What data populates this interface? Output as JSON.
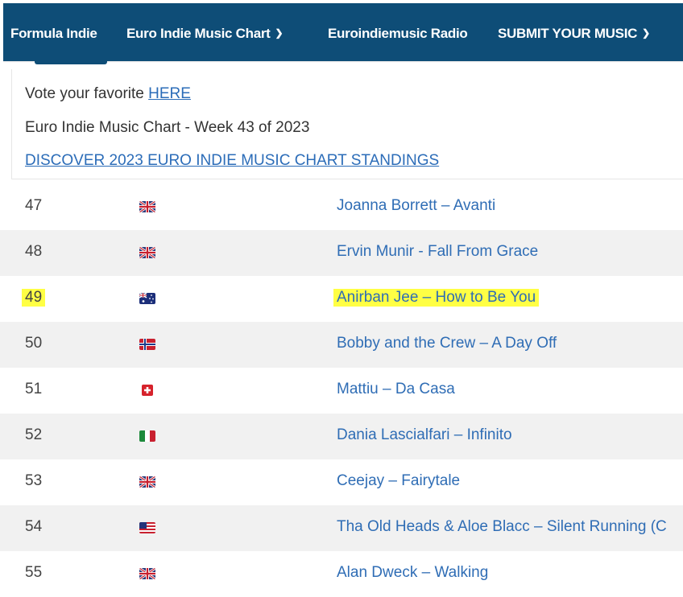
{
  "nav": {
    "items": [
      {
        "label": "Formula Indie"
      },
      {
        "label": "Euro Indie Music Chart"
      },
      {
        "label": "Euroindiemusic Radio"
      },
      {
        "label": "SUBMIT YOUR MUSIC"
      }
    ]
  },
  "info": {
    "vote_text": "Vote your favorite ",
    "vote_link": "HERE",
    "week_text": "Euro Indie Music Chart - Week 43 of 2023",
    "discover_link": "DISCOVER 2023 EURO INDIE MUSIC CHART STANDINGS"
  },
  "chart": {
    "highlight_color": "#ffff44",
    "rows": [
      {
        "rank": "47",
        "flag": "uk-flag-icon",
        "title": "Joanna Borrett – Avanti"
      },
      {
        "rank": "48",
        "flag": "uk-flag-icon",
        "title": "Ervin Munir - Fall From Grace"
      },
      {
        "rank": "49",
        "flag": "australia-flag-icon",
        "title": "Anirban Jee – How to Be You",
        "highlighted": true
      },
      {
        "rank": "50",
        "flag": "norway-flag-icon",
        "title": "Bobby and the Crew – A Day Off"
      },
      {
        "rank": "51",
        "flag": "switzerland-flag-icon",
        "title": "Mattiu – Da Casa"
      },
      {
        "rank": "52",
        "flag": "italy-flag-icon",
        "title": "Dania Lascialfari – Infinito"
      },
      {
        "rank": "53",
        "flag": "uk-flag-icon",
        "title": "Ceejay – Fairytale"
      },
      {
        "rank": "54",
        "flag": "usa-flag-icon",
        "title": "Tha Old Heads & Aloe Blacc – Silent Running (C"
      },
      {
        "rank": "55",
        "flag": "uk-flag-icon",
        "title": "Alan Dweck – Walking"
      }
    ]
  }
}
